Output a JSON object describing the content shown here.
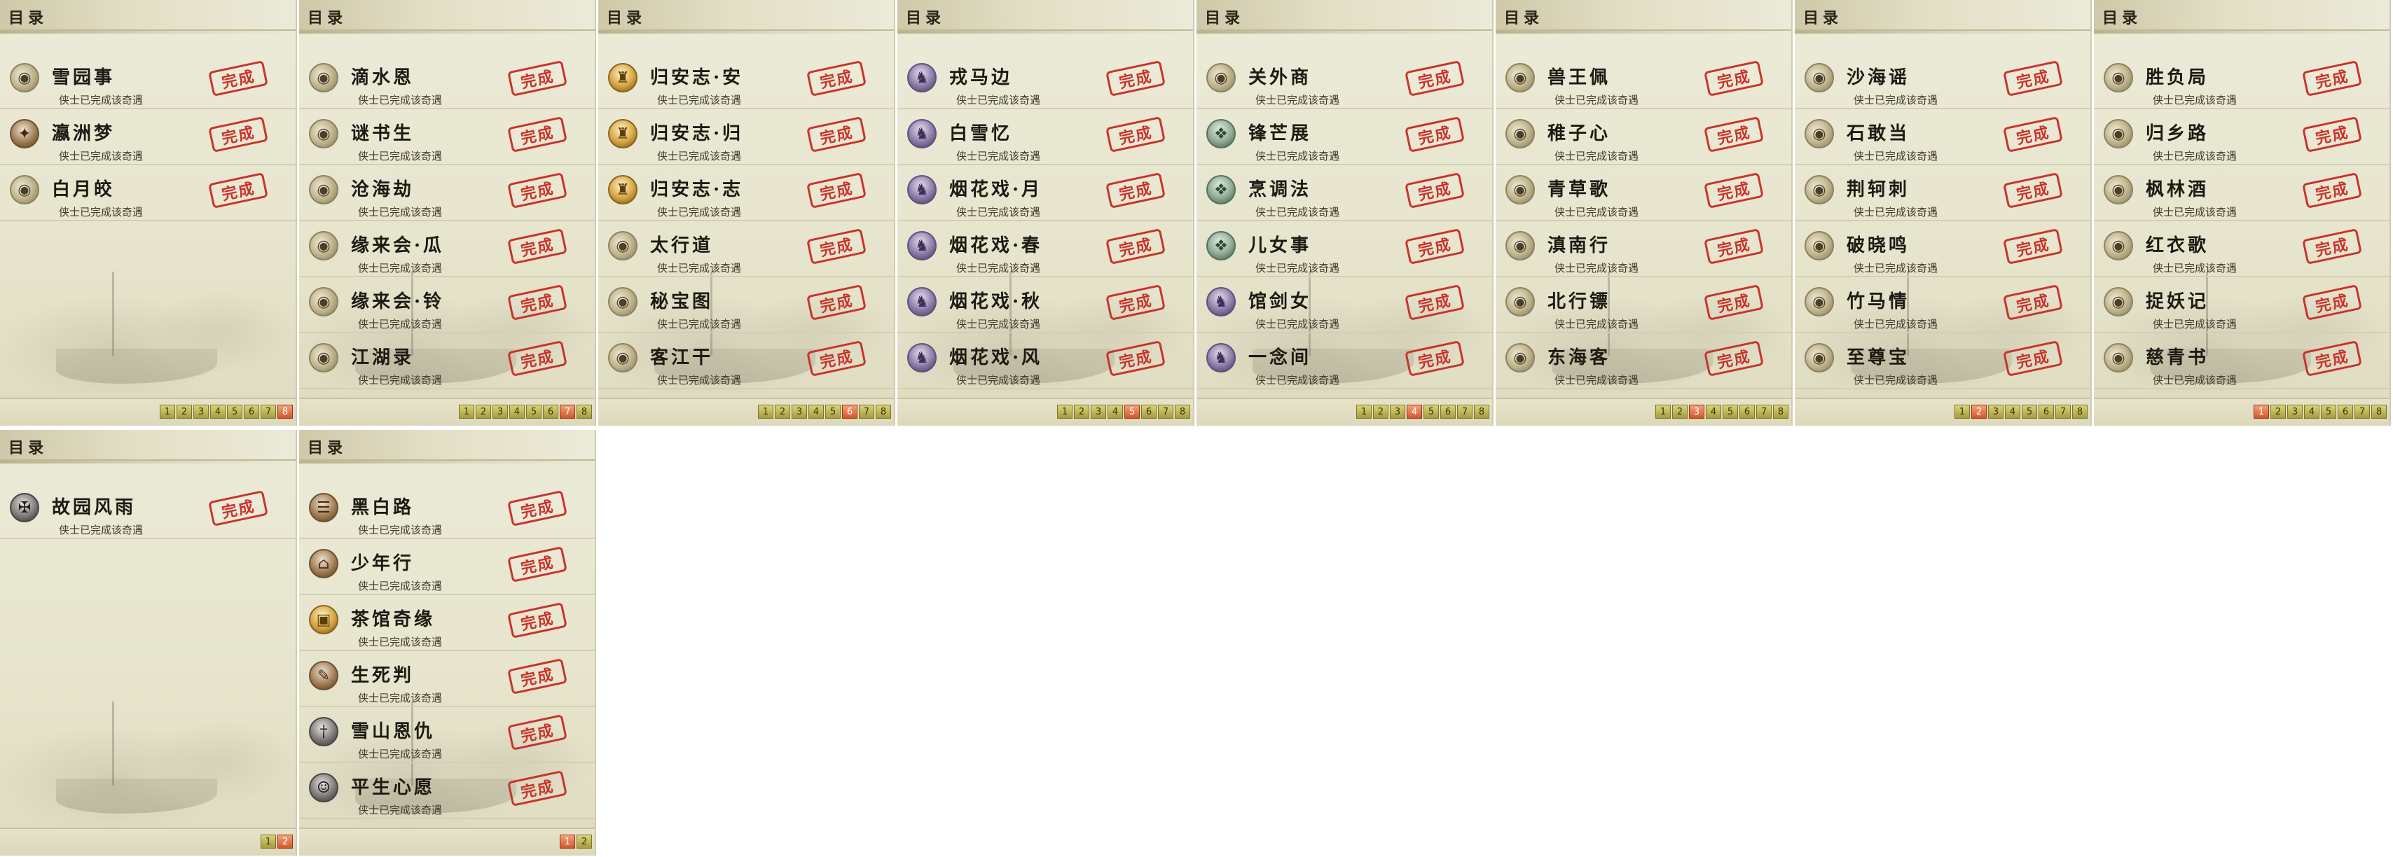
{
  "stamp_label": "完成",
  "panels": [
    {
      "title": "目录",
      "items": [
        {
          "name": "雪园事",
          "desc": "侠士已完成该奇遇",
          "icon": "round-emblem-icon"
        },
        {
          "name": "瀛洲梦",
          "desc": "侠士已完成该奇遇",
          "icon": "eagle-icon"
        },
        {
          "name": "白月皎",
          "desc": "侠士已完成该奇遇",
          "icon": "round-emblem-icon"
        }
      ],
      "pages": [
        "1",
        "2",
        "3",
        "4",
        "5",
        "6",
        "7",
        "8"
      ],
      "active_page": "8"
    },
    {
      "title": "目录",
      "items": [
        {
          "name": "滴水恩",
          "desc": "侠士已完成该奇遇",
          "icon": "round-emblem-icon"
        },
        {
          "name": "谜书生",
          "desc": "侠士已完成该奇遇",
          "icon": "round-emblem-icon"
        },
        {
          "name": "沧海劫",
          "desc": "侠士已完成该奇遇",
          "icon": "round-emblem-icon"
        },
        {
          "name": "缘来会·瓜",
          "desc": "侠士已完成该奇遇",
          "icon": "round-emblem-icon"
        },
        {
          "name": "缘来会·铃",
          "desc": "侠士已完成该奇遇",
          "icon": "round-emblem-icon"
        },
        {
          "name": "江湖录",
          "desc": "侠士已完成该奇遇",
          "icon": "round-emblem-icon"
        }
      ],
      "pages": [
        "1",
        "2",
        "3",
        "4",
        "5",
        "6",
        "7",
        "8"
      ],
      "active_page": "7"
    },
    {
      "title": "目录",
      "items": [
        {
          "name": "归安志·安",
          "desc": "侠士已完成该奇遇",
          "icon": "gold-idol-icon"
        },
        {
          "name": "归安志·归",
          "desc": "侠士已完成该奇遇",
          "icon": "gold-idol-icon"
        },
        {
          "name": "归安志·志",
          "desc": "侠士已完成该奇遇",
          "icon": "gold-idol-icon"
        },
        {
          "name": "太行道",
          "desc": "侠士已完成该奇遇",
          "icon": "round-emblem-icon"
        },
        {
          "name": "秘宝图",
          "desc": "侠士已完成该奇遇",
          "icon": "round-emblem-icon"
        },
        {
          "name": "客江干",
          "desc": "侠士已完成该奇遇",
          "icon": "round-emblem-icon"
        }
      ],
      "pages": [
        "1",
        "2",
        "3",
        "4",
        "5",
        "6",
        "7",
        "8"
      ],
      "active_page": "6"
    },
    {
      "title": "目录",
      "items": [
        {
          "name": "戎马边",
          "desc": "侠士已完成该奇遇",
          "icon": "purple-figure-icon"
        },
        {
          "name": "白雪忆",
          "desc": "侠士已完成该奇遇",
          "icon": "purple-figure-icon"
        },
        {
          "name": "烟花戏·月",
          "desc": "侠士已完成该奇遇",
          "icon": "purple-figure-icon"
        },
        {
          "name": "烟花戏·春",
          "desc": "侠士已完成该奇遇",
          "icon": "purple-figure-icon"
        },
        {
          "name": "烟花戏·秋",
          "desc": "侠士已完成该奇遇",
          "icon": "purple-figure-icon"
        },
        {
          "name": "烟花戏·风",
          "desc": "侠士已完成该奇遇",
          "icon": "purple-figure-icon"
        }
      ],
      "pages": [
        "1",
        "2",
        "3",
        "4",
        "5",
        "6",
        "7",
        "8"
      ],
      "active_page": "5"
    },
    {
      "title": "目录",
      "items": [
        {
          "name": "关外商",
          "desc": "侠士已完成该奇遇",
          "icon": "round-emblem-icon"
        },
        {
          "name": "锋芒展",
          "desc": "侠士已完成该奇遇",
          "icon": "jade-emblem-icon"
        },
        {
          "name": "烹调法",
          "desc": "侠士已完成该奇遇",
          "icon": "jade-emblem-icon"
        },
        {
          "name": "儿女事",
          "desc": "侠士已完成该奇遇",
          "icon": "jade-emblem-icon"
        },
        {
          "name": "馆剑女",
          "desc": "侠士已完成该奇遇",
          "icon": "purple-figure-icon"
        },
        {
          "name": "一念间",
          "desc": "侠士已完成该奇遇",
          "icon": "purple-figure-icon"
        }
      ],
      "pages": [
        "1",
        "2",
        "3",
        "4",
        "5",
        "6",
        "7",
        "8"
      ],
      "active_page": "4"
    },
    {
      "title": "目录",
      "items": [
        {
          "name": "兽王佩",
          "desc": "侠士已完成该奇遇",
          "icon": "round-emblem-icon"
        },
        {
          "name": "稚子心",
          "desc": "侠士已完成该奇遇",
          "icon": "round-emblem-icon"
        },
        {
          "name": "青草歌",
          "desc": "侠士已完成该奇遇",
          "icon": "round-emblem-icon"
        },
        {
          "name": "滇南行",
          "desc": "侠士已完成该奇遇",
          "icon": "round-emblem-icon"
        },
        {
          "name": "北行镖",
          "desc": "侠士已完成该奇遇",
          "icon": "round-emblem-icon"
        },
        {
          "name": "东海客",
          "desc": "侠士已完成该奇遇",
          "icon": "round-emblem-icon"
        }
      ],
      "pages": [
        "1",
        "2",
        "3",
        "4",
        "5",
        "6",
        "7",
        "8"
      ],
      "active_page": "3"
    },
    {
      "title": "目录",
      "items": [
        {
          "name": "沙海谣",
          "desc": "侠士已完成该奇遇",
          "icon": "round-emblem-icon"
        },
        {
          "name": "石敢当",
          "desc": "侠士已完成该奇遇",
          "icon": "round-emblem-icon"
        },
        {
          "name": "荆轲刺",
          "desc": "侠士已完成该奇遇",
          "icon": "round-emblem-icon"
        },
        {
          "name": "破晓鸣",
          "desc": "侠士已完成该奇遇",
          "icon": "round-emblem-icon"
        },
        {
          "name": "竹马情",
          "desc": "侠士已完成该奇遇",
          "icon": "round-emblem-icon"
        },
        {
          "name": "至尊宝",
          "desc": "侠士已完成该奇遇",
          "icon": "round-emblem-icon"
        }
      ],
      "pages": [
        "1",
        "2",
        "3",
        "4",
        "5",
        "6",
        "7",
        "8"
      ],
      "active_page": "2"
    },
    {
      "title": "目录",
      "items": [
        {
          "name": "胜负局",
          "desc": "侠士已完成该奇遇",
          "icon": "round-emblem-icon"
        },
        {
          "name": "归乡路",
          "desc": "侠士已完成该奇遇",
          "icon": "round-emblem-icon"
        },
        {
          "name": "枫林酒",
          "desc": "侠士已完成该奇遇",
          "icon": "round-emblem-icon"
        },
        {
          "name": "红衣歌",
          "desc": "侠士已完成该奇遇",
          "icon": "round-emblem-icon"
        },
        {
          "name": "捉妖记",
          "desc": "侠士已完成该奇遇",
          "icon": "round-emblem-icon"
        },
        {
          "name": "慈青书",
          "desc": "侠士已完成该奇遇",
          "icon": "round-emblem-icon"
        }
      ],
      "pages": [
        "1",
        "2",
        "3",
        "4",
        "5",
        "6",
        "7",
        "8"
      ],
      "active_page": "1"
    },
    {
      "title": "目录",
      "items": [
        {
          "name": "故园风雨",
          "desc": "侠士已完成该奇遇",
          "icon": "dark-crest-icon"
        }
      ],
      "pages": [
        "1",
        "2"
      ],
      "active_page": "2"
    },
    {
      "title": "目录",
      "items": [
        {
          "name": "黑白路",
          "desc": "侠士已完成该奇遇",
          "icon": "scroll-icon"
        },
        {
          "name": "少年行",
          "desc": "侠士已完成该奇遇",
          "icon": "hat-icon"
        },
        {
          "name": "茶馆奇缘",
          "desc": "侠士已完成该奇遇",
          "icon": "chest-icon"
        },
        {
          "name": "生死判",
          "desc": "侠士已完成该奇遇",
          "icon": "brush-icon"
        },
        {
          "name": "雪山恩仇",
          "desc": "侠士已完成该奇遇",
          "icon": "sword-icon"
        },
        {
          "name": "平生心愿",
          "desc": "侠士已完成该奇遇",
          "icon": "girl-portrait-icon"
        }
      ],
      "pages": [
        "1",
        "2"
      ],
      "active_page": "1"
    }
  ]
}
